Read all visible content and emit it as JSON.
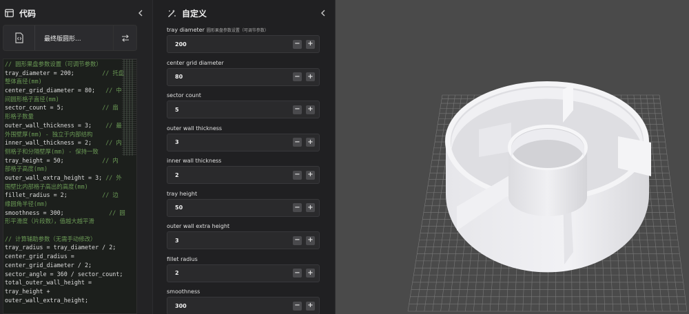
{
  "code_panel": {
    "title": "代码",
    "file_name": "最终版圆形..."
  },
  "code_lines": [
    [
      [
        "cm",
        "// 圆形果盘参数设置（可调节参数）"
      ]
    ],
    [
      [
        "",
        "tray_diameter = 200;        "
      ],
      [
        "cm",
        "// 托盘"
      ]
    ],
    [
      [
        "cm",
        "整体直径(mm)"
      ]
    ],
    [
      [
        "",
        "center_grid_diameter = 80;   "
      ],
      [
        "cm",
        "// 中"
      ]
    ],
    [
      [
        "cm",
        "间圆形格子直径(mm)"
      ]
    ],
    [
      [
        "",
        "sector_count = 5;           "
      ],
      [
        "cm",
        "// 扇"
      ]
    ],
    [
      [
        "cm",
        "形格子数量"
      ]
    ],
    [
      [
        "",
        "outer_wall_thickness = 3;    "
      ],
      [
        "cm",
        "// 最"
      ]
    ],
    [
      [
        "cm",
        "外围壁厚(mm) - 独立于内部结构"
      ]
    ],
    [
      [
        "",
        "inner_wall_thickness = 2;    "
      ],
      [
        "cm",
        "// 内"
      ]
    ],
    [
      [
        "cm",
        "侧格子和分隔壁厚(mm) - 保持一致"
      ]
    ],
    [
      [
        "",
        "tray_height = 50;           "
      ],
      [
        "cm",
        "// 内"
      ]
    ],
    [
      [
        "cm",
        "部格子高度(mm)"
      ]
    ],
    [
      [
        "",
        "outer_wall_extra_height = 3; "
      ],
      [
        "cm",
        "// 外"
      ]
    ],
    [
      [
        "cm",
        "围壁比内部格子高出的高度(mm)"
      ]
    ],
    [
      [
        "",
        "fillet_radius = 2;          "
      ],
      [
        "cm",
        "// 边"
      ]
    ],
    [
      [
        "cm",
        "缘圆角半径(mm)"
      ]
    ],
    [
      [
        "",
        "smoothness = 300;             "
      ],
      [
        "cm",
        "// 圆"
      ]
    ],
    [
      [
        "cm",
        "形平滑度（片段数），值越大越平滑"
      ]
    ],
    [
      [
        "",
        ""
      ]
    ],
    [
      [
        "cm",
        "// 计算辅助参数（无需手动修改）"
      ]
    ],
    [
      [
        "",
        "tray_radius = tray_diameter / 2;"
      ]
    ],
    [
      [
        "",
        "center_grid_radius ="
      ]
    ],
    [
      [
        "",
        "center_grid_diameter / 2;"
      ]
    ],
    [
      [
        "",
        "sector_angle = 360 / sector_count;"
      ]
    ],
    [
      [
        "",
        "total_outer_wall_height ="
      ]
    ],
    [
      [
        "",
        "tray_height +"
      ]
    ],
    [
      [
        "",
        "outer_wall_extra_height;"
      ]
    ]
  ],
  "custom_panel": {
    "title": "自定义"
  },
  "params": [
    {
      "label": "tray diameter",
      "note": "圆形果盘参数设置（可调节参数）",
      "value": "200"
    },
    {
      "label": "center grid diameter",
      "note": "",
      "value": "80"
    },
    {
      "label": "sector count",
      "note": "",
      "value": "5"
    },
    {
      "label": "outer wall thickness",
      "note": "",
      "value": "3"
    },
    {
      "label": "inner wall thickness",
      "note": "",
      "value": "2"
    },
    {
      "label": "tray height",
      "note": "",
      "value": "50"
    },
    {
      "label": "outer wall extra height",
      "note": "",
      "value": "3"
    },
    {
      "label": "fillet radius",
      "note": "",
      "value": "2"
    },
    {
      "label": "smoothness",
      "note": "",
      "value": "300"
    }
  ],
  "stepper": {
    "minus": "−",
    "plus": "+"
  },
  "colors": {
    "comment": "#6a9955",
    "viewport_bg": "#4a4a4a",
    "model": "#ececf0"
  },
  "icons": {
    "code_panel": "code-panel-icon",
    "custom_panel": "customize-wand-icon",
    "file": "code-file-icon",
    "swap": "swap-arrows-icon",
    "collapse": "chevron-left-icon"
  }
}
